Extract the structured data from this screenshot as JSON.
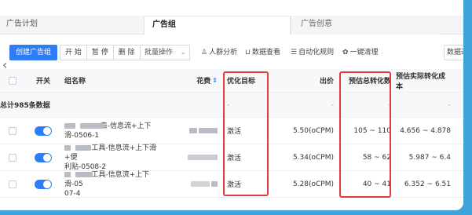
{
  "tabs": [
    {
      "label": "广告计划"
    },
    {
      "label": "广告组"
    },
    {
      "label": "广告创意"
    }
  ],
  "toolbar": {
    "create": "创建广告组",
    "start": "开 始",
    "pause": "暂 停",
    "delete": "删 除",
    "batch": "批量操作",
    "crowd": "人群分析",
    "data_view": "数据查看",
    "auto_rule": "自动化规则",
    "clean": "一键清理",
    "data_right": "数据过"
  },
  "table": {
    "headers": {
      "switch": "开关",
      "name": "组名称",
      "cost": "花费",
      "goal": "优化目标",
      "bid": "出价",
      "conv": "预估总转化数",
      "rate": "预估实际转化成本"
    },
    "total": {
      "label": "总计985条数据",
      "goal": "-",
      "bid": "-",
      "conv": "-",
      "rate": "-"
    },
    "rows": [
      {
        "name_a": "                表-信息流+上下",
        "name_b": "滑-0506-1",
        "goal": "激活",
        "bid": "5.50(oCPM)",
        "conv": "105 ~ 110",
        "rate": "4.656 ~ 4.878"
      },
      {
        "name_a": "            工具-信息流+上下滑+便",
        "name_b": "利贴-0508-2",
        "goal": "激活",
        "bid": "5.34(oCPM)",
        "conv": "58 ~ 62",
        "rate": "5.987 ~ 6.4"
      },
      {
        "name_a": "            工具-信息流+上下滑-05",
        "name_b": "07-4",
        "goal": "激活",
        "bid": "5.28(oCPM)",
        "conv": "40 ~ 41",
        "rate": "6.352 ~ 6.51"
      }
    ]
  },
  "colors": {
    "accent": "#2f7df6",
    "highlight": "#e23b3b",
    "background": "#3fa3dc"
  },
  "icons": {
    "crowd": "person-icon",
    "data": "chart-icon",
    "rule": "rules-icon",
    "clean": "broom-icon",
    "back": "chevron-left-icon"
  }
}
